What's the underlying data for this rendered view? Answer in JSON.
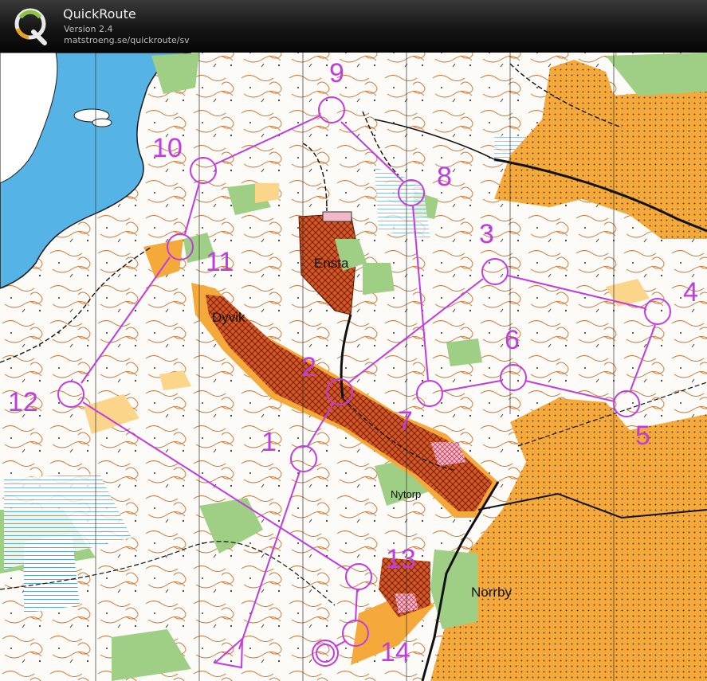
{
  "app": {
    "name": "QuickRoute",
    "version": "Version 2.4",
    "url": "matstroeng.se/quickroute/sv"
  },
  "colors": {
    "course": "#c03ce0",
    "forest": "#ffffff",
    "open_land": "#f5a93a",
    "rough_open": "#fbd58a",
    "water": "#55b3e6",
    "settlement": "#c8501f",
    "green": "#9fcf85",
    "contours": "#c77430"
  },
  "place_names": {
    "ensta": "Ensta",
    "dyvik": "Dyvik",
    "nytorp": "Nytorp",
    "norrby": "Norrby"
  },
  "course": {
    "start_label": "start",
    "controls": [
      {
        "label": "1"
      },
      {
        "label": "2"
      },
      {
        "label": "3"
      },
      {
        "label": "4"
      },
      {
        "label": "5"
      },
      {
        "label": "6"
      },
      {
        "label": "7"
      },
      {
        "label": "8"
      },
      {
        "label": "9"
      },
      {
        "label": "10"
      },
      {
        "label": "11"
      },
      {
        "label": "12"
      },
      {
        "label": "13"
      },
      {
        "label": "14"
      }
    ],
    "finish_label": "finish"
  }
}
